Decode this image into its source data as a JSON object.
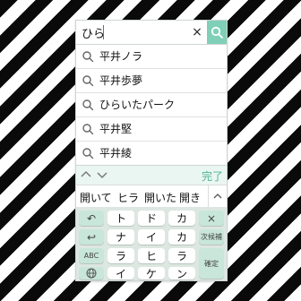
{
  "search": {
    "query": "ひら",
    "clear_icon": "×"
  },
  "suggestions": [
    {
      "label": "平井ノラ",
      "icon": "search-icon"
    },
    {
      "label": "平井歩夢",
      "icon": "search-icon"
    },
    {
      "label": "ひらいたパーク",
      "icon": "search-icon"
    },
    {
      "label": "平井堅",
      "icon": "search-icon"
    },
    {
      "label": "平井綾",
      "icon": "search-icon"
    }
  ],
  "toolbar": {
    "done_label": "完了"
  },
  "candidates": {
    "items": [
      "開いて",
      "ヒラ",
      "開いた",
      "開き"
    ]
  },
  "keyboard": {
    "keys": {
      "undo": "↶",
      "to": "ト",
      "do": "ド",
      "ka": "カ",
      "delete": "×",
      "back": "↩",
      "na": "ナ",
      "i_row2": "イ",
      "ka_row2": "カ",
      "next_candidate": "次候補",
      "abc": "ABC",
      "ra": "ラ",
      "hi": "ヒ",
      "ra_row3": "ラ",
      "confirm": "確定",
      "i_row4": "イ",
      "ke": "ケ",
      "n": "ン"
    }
  },
  "colors": {
    "accent": "#7fd0b6",
    "accent_text": "#4fb596",
    "toolbar_bg": "#eaf6f1",
    "keyboard_bg": "#dde7e2",
    "function_key": "#c8e6da"
  }
}
